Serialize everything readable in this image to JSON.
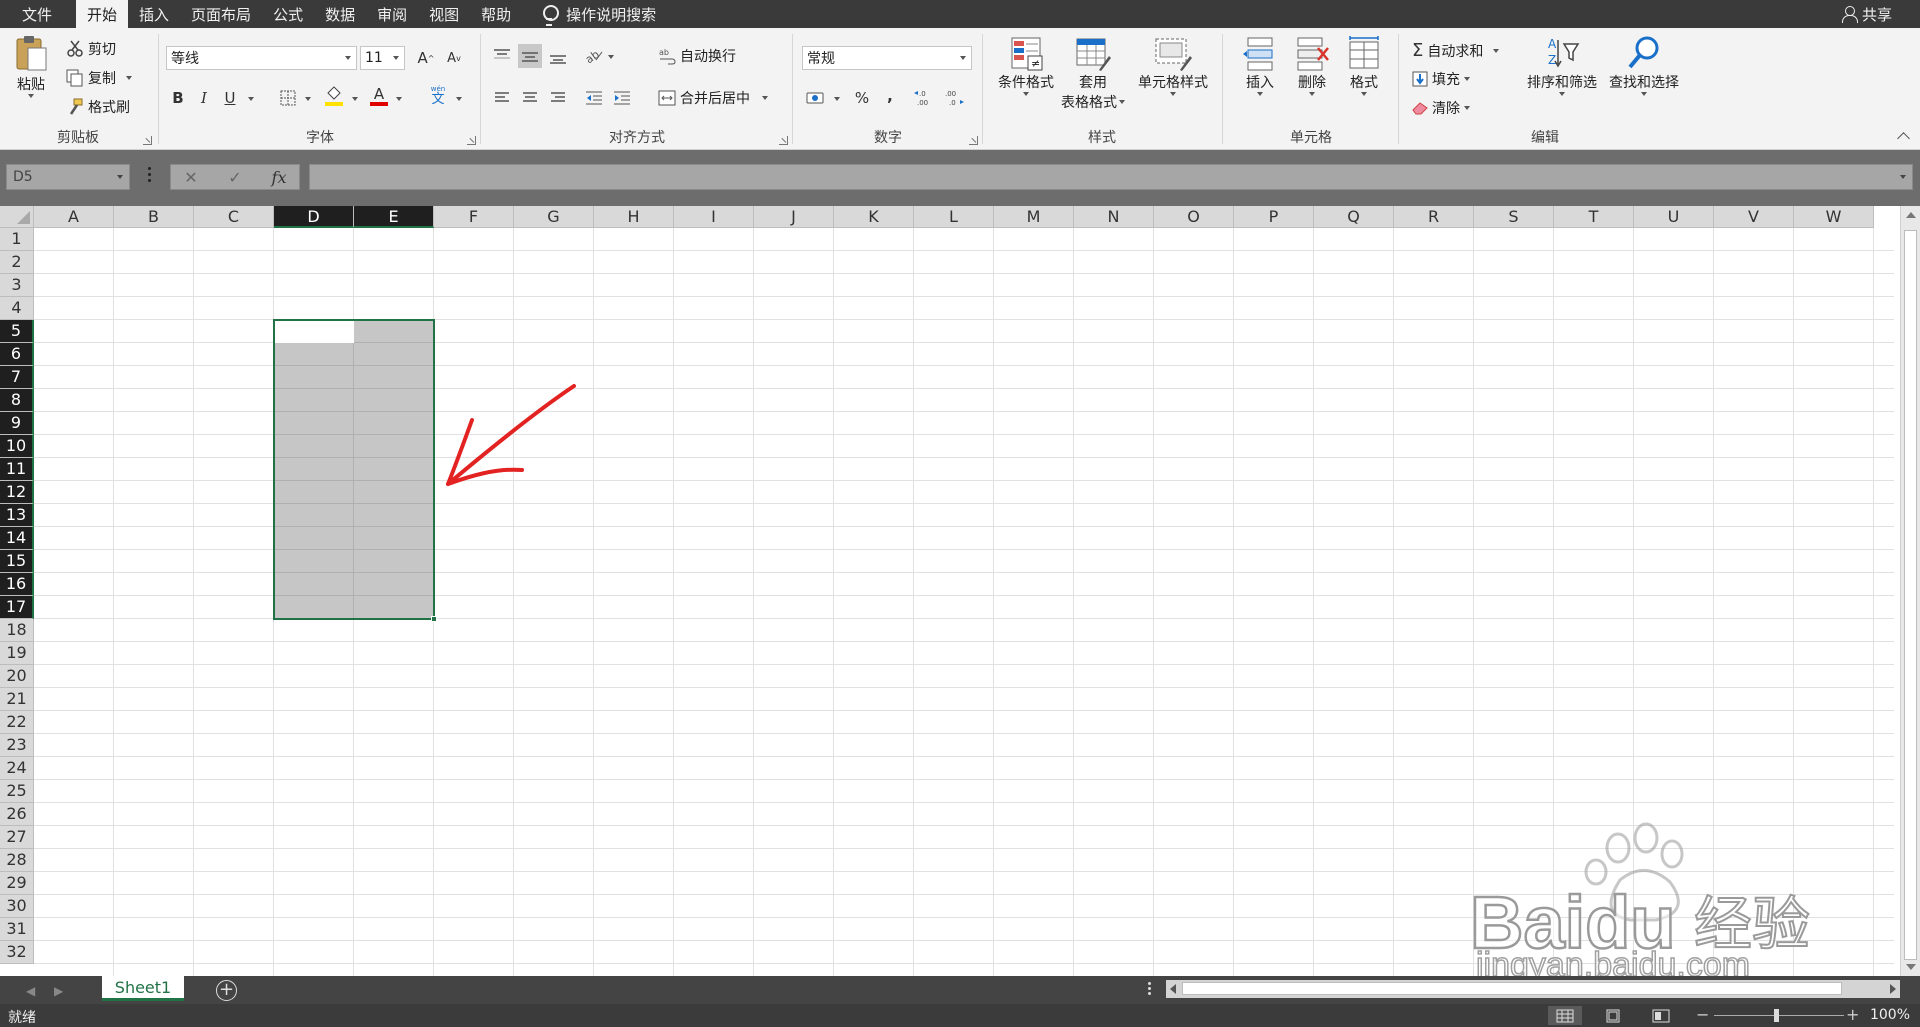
{
  "menu": {
    "tabs": [
      "文件",
      "开始",
      "插入",
      "页面布局",
      "公式",
      "数据",
      "审阅",
      "视图",
      "帮助"
    ],
    "active_tab": "开始",
    "tell_me": "操作说明搜索",
    "share": "共享"
  },
  "ribbon": {
    "clipboard": {
      "paste": "粘贴",
      "cut": "剪切",
      "copy": "复制",
      "format_painter": "格式刷",
      "label": "剪贴板"
    },
    "font": {
      "name": "等线",
      "size": "11",
      "bold": "B",
      "italic": "I",
      "underline": "U",
      "grow": "A",
      "shrink": "A",
      "font_color_glyph": "A",
      "phonetic_glyph": "文",
      "phonetic_small": "wén",
      "label": "字体"
    },
    "alignment": {
      "wrap": "自动换行",
      "merge": "合并后居中",
      "label": "对齐方式"
    },
    "number": {
      "format": "常规",
      "percent": "%",
      "comma": ",",
      "inc_decimal": "←.0\n.00",
      "dec_decimal": ".00\n→.0",
      "label": "数字"
    },
    "styles": {
      "conditional": "条件格式",
      "table_l1": "套用",
      "table_l2": "表格格式",
      "cell_styles": "单元格样式",
      "label": "样式"
    },
    "cells": {
      "insert": "插入",
      "delete": "删除",
      "format": "格式",
      "label": "单元格"
    },
    "editing": {
      "autosum": "自动求和",
      "fill": "填充",
      "clear": "清除",
      "sort": "排序和筛选",
      "find": "查找和选择",
      "label": "编辑"
    }
  },
  "formula_bar": {
    "name_box": "D5",
    "cancel": "✕",
    "enter": "✓",
    "fx": "fx",
    "value": ""
  },
  "grid": {
    "columns": [
      "A",
      "B",
      "C",
      "D",
      "E",
      "F",
      "G",
      "H",
      "I",
      "J",
      "K",
      "L",
      "M",
      "N",
      "O",
      "P",
      "Q",
      "R",
      "S",
      "T",
      "U",
      "V",
      "W"
    ],
    "rows": [
      "1",
      "2",
      "3",
      "4",
      "5",
      "6",
      "7",
      "8",
      "9",
      "10",
      "11",
      "12",
      "13",
      "14",
      "15",
      "16",
      "17",
      "18",
      "19",
      "20",
      "21",
      "22",
      "23",
      "24",
      "25",
      "26",
      "27",
      "28",
      "29",
      "30",
      "31",
      "32"
    ],
    "selection": {
      "range": "D5:E17",
      "active_cell": "D5",
      "selected_columns": [
        "D",
        "E"
      ],
      "first_row": 5,
      "last_row": 17
    }
  },
  "sheets": {
    "tabs": [
      "Sheet1"
    ],
    "active": "Sheet1",
    "add_label": "+"
  },
  "status": {
    "text": "就绪",
    "zoom": "100%",
    "zoom_minus": "−",
    "zoom_plus": "+"
  },
  "watermark": {
    "brand": "Baidu",
    "brand_cn": "经验",
    "url": "jingyan.baidu.com"
  },
  "colors": {
    "accent": "#217346",
    "annotation": "#e32222",
    "menubar": "#3a3a3a",
    "selection_fill": "#c6c6c6"
  }
}
